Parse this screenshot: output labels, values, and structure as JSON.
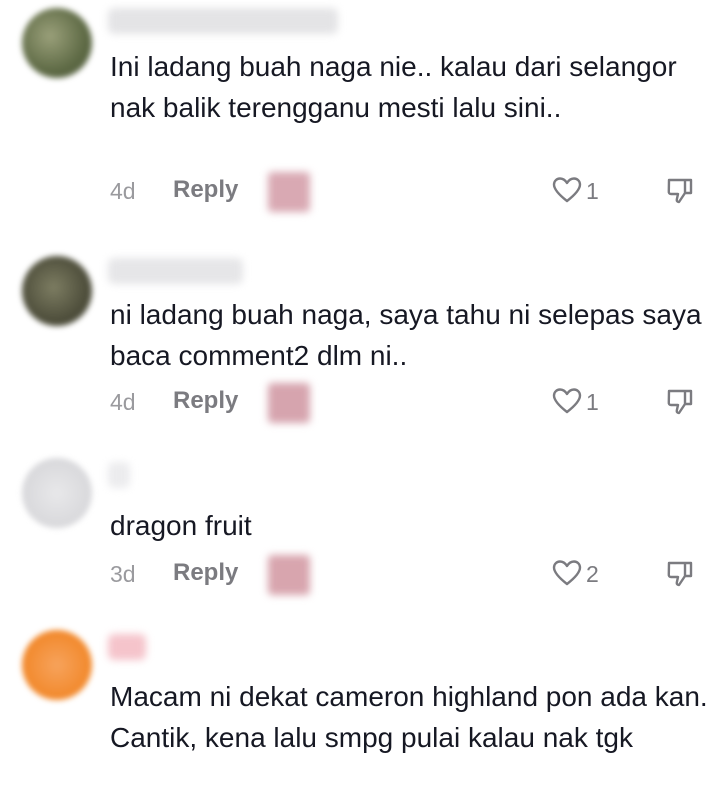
{
  "comments": [
    {
      "text": "Ini ladang buah naga nie.. kalau dari selangor nak balik terengganu mesti lalu sini..",
      "time": "4d",
      "reply_label": "Reply",
      "likes": "1",
      "avatar_color": "#6f7a58",
      "reply_blur_color": "#d9a9b3"
    },
    {
      "text": "ni ladang buah naga, saya tahu ni selepas saya baca comment2 dlm ni..",
      "time": "4d",
      "reply_label": "Reply",
      "likes": "1",
      "avatar_color": "#5d5a45",
      "reply_blur_color": "#d6a4ae"
    },
    {
      "text": "dragon fruit",
      "time": "3d",
      "reply_label": "Reply",
      "likes": "2",
      "avatar_color": "#d9d9dc",
      "reply_blur_color": "#d8a5ae"
    },
    {
      "text": "Macam ni dekat cameron highland pon ada kan. Cantik, kena lalu smpg pulai kalau nak tgk",
      "avatar_color": "#f28a2e"
    }
  ]
}
